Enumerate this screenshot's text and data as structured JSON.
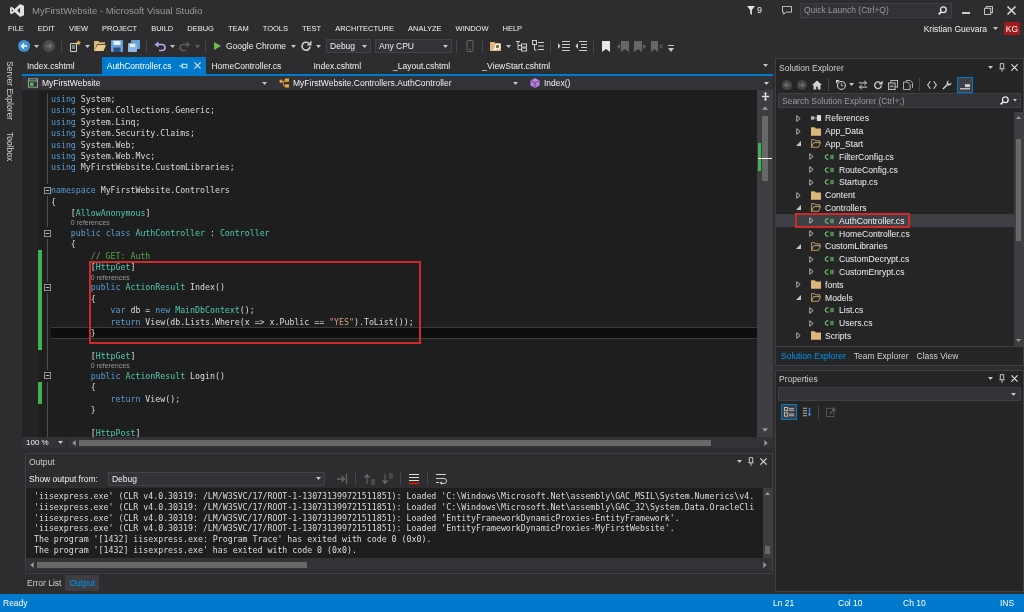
{
  "window": {
    "title": "MyFirstWebsite - Microsoft Visual Studio",
    "notifications": "9",
    "quick_launch": {
      "placeholder": "Quick Launch (Ctrl+Q)"
    },
    "user": {
      "name": "Kristian Guevara",
      "initials": "KG"
    }
  },
  "menu": [
    "FILE",
    "EDIT",
    "VIEW",
    "PROJECT",
    "BUILD",
    "DEBUG",
    "TEAM",
    "TOOLS",
    "TEST",
    "ARCHITECTURE",
    "ANALYZE",
    "WINDOW",
    "HELP"
  ],
  "toolbar": [
    {
      "kind": "back",
      "disabled": false
    },
    {
      "kind": "caret",
      "disabled": false
    },
    {
      "kind": "forward",
      "disabled": true
    },
    {
      "kind": "separator"
    },
    {
      "kind": "new-item",
      "disabled": false
    },
    {
      "kind": "caret",
      "disabled": false
    },
    {
      "kind": "open",
      "disabled": false
    },
    {
      "kind": "save",
      "disabled": false
    },
    {
      "kind": "save-all",
      "disabled": false
    },
    {
      "kind": "separator"
    },
    {
      "kind": "undo",
      "disabled": false
    },
    {
      "kind": "caret",
      "disabled": false
    },
    {
      "kind": "redo",
      "disabled": true
    },
    {
      "kind": "caret",
      "disabled": true
    },
    {
      "kind": "separator"
    },
    {
      "kind": "run",
      "label": "Google Chrome",
      "disabled": false
    },
    {
      "kind": "caret",
      "disabled": false
    },
    {
      "kind": "refresh",
      "disabled": false
    },
    {
      "kind": "caret",
      "disabled": false
    },
    {
      "kind": "combo",
      "value": "Debug",
      "disabled": false
    },
    {
      "kind": "combo",
      "value": "Any CPU",
      "disabled": false
    },
    {
      "kind": "separator"
    },
    {
      "kind": "device",
      "disabled": true
    },
    {
      "kind": "separator"
    },
    {
      "kind": "find",
      "disabled": false
    },
    {
      "kind": "caret",
      "disabled": false
    },
    {
      "kind": "outline",
      "disabled": false
    },
    {
      "kind": "list",
      "disabled": false
    },
    {
      "kind": "separator"
    },
    {
      "kind": "indent",
      "disabled": false
    },
    {
      "kind": "outdent",
      "disabled": false
    },
    {
      "kind": "separator"
    },
    {
      "kind": "bookmark",
      "disabled": false
    },
    {
      "kind": "bookmark-prev",
      "disabled": true
    },
    {
      "kind": "bookmark-next",
      "disabled": true
    },
    {
      "kind": "bookmark-clear",
      "disabled": true
    },
    {
      "kind": "overflow",
      "disabled": false
    }
  ],
  "side_tabs": [
    "Server Explorer",
    "Toolbox"
  ],
  "document_tabs": [
    {
      "label": "Index.cshtml",
      "selected": false
    },
    {
      "label": "AuthController.cs",
      "selected": true
    },
    {
      "label": "HomeController.cs",
      "selected": false
    },
    {
      "label": "Index.cshtml",
      "selected": false
    },
    {
      "label": "_Layout.cshtml",
      "selected": false
    },
    {
      "label": "_ViewStart.cshtml",
      "selected": false
    }
  ],
  "navigation": {
    "project": "MyFirstWebsite",
    "type": "MyFirstWebsite.Controllers.AuthController",
    "member": "Index()"
  },
  "editor": {
    "lines": [
      {
        "kind": "code",
        "tokens": [
          {
            "kind": "keyword",
            "text": "using"
          },
          {
            "kind": "plain",
            "text": " System;"
          }
        ],
        "fold": false,
        "changed": false,
        "current": false
      },
      {
        "kind": "code",
        "tokens": [
          {
            "kind": "keyword",
            "text": "using"
          },
          {
            "kind": "plain",
            "text": " System.Collections.Generic;"
          }
        ],
        "fold": false,
        "changed": false,
        "current": false
      },
      {
        "kind": "code",
        "tokens": [
          {
            "kind": "keyword",
            "text": "using"
          },
          {
            "kind": "plain",
            "text": " System.Linq;"
          }
        ],
        "fold": false,
        "changed": false,
        "current": false
      },
      {
        "kind": "code",
        "tokens": [
          {
            "kind": "keyword",
            "text": "using"
          },
          {
            "kind": "plain",
            "text": " System.Security.Claims;"
          }
        ],
        "fold": false,
        "changed": false,
        "current": false
      },
      {
        "kind": "code",
        "tokens": [
          {
            "kind": "keyword",
            "text": "using"
          },
          {
            "kind": "plain",
            "text": " System.Web;"
          }
        ],
        "fold": false,
        "changed": false,
        "current": false
      },
      {
        "kind": "code",
        "tokens": [
          {
            "kind": "keyword",
            "text": "using"
          },
          {
            "kind": "plain",
            "text": " System.Web.Mvc;"
          }
        ],
        "fold": false,
        "changed": false,
        "current": false
      },
      {
        "kind": "code",
        "tokens": [
          {
            "kind": "keyword",
            "text": "using"
          },
          {
            "kind": "plain",
            "text": " MyFirstWebsite.CustomLibraries;"
          }
        ],
        "fold": false,
        "changed": false,
        "current": false
      },
      {
        "kind": "blank",
        "fold": false,
        "changed": false,
        "current": false
      },
      {
        "kind": "code",
        "tokens": [
          {
            "kind": "keyword",
            "text": "namespace"
          },
          {
            "kind": "plain",
            "text": " MyFirstWebsite.Controllers"
          }
        ],
        "fold": true,
        "changed": false,
        "current": false
      },
      {
        "kind": "code",
        "tokens": [
          {
            "kind": "plain",
            "text": "{"
          }
        ],
        "fold": false,
        "changed": false,
        "current": false
      },
      {
        "kind": "code",
        "tokens": [
          {
            "kind": "plain",
            "text": "    ["
          },
          {
            "kind": "type",
            "text": "AllowAnonymous"
          },
          {
            "kind": "plain",
            "text": "]"
          }
        ],
        "fold": false,
        "changed": false,
        "current": false
      },
      {
        "kind": "codelens",
        "text": "    0 references",
        "fold": false,
        "changed": false,
        "current": false
      },
      {
        "kind": "code",
        "tokens": [
          {
            "kind": "keyword",
            "text": "    public class "
          },
          {
            "kind": "type",
            "text": "AuthController"
          },
          {
            "kind": "plain",
            "text": " : "
          },
          {
            "kind": "type",
            "text": "Controller"
          }
        ],
        "fold": true,
        "changed": false,
        "current": false
      },
      {
        "kind": "code",
        "tokens": [
          {
            "kind": "plain",
            "text": "    {"
          }
        ],
        "fold": false,
        "changed": false,
        "current": false
      },
      {
        "kind": "code",
        "tokens": [
          {
            "kind": "comment",
            "text": "        // GET: Auth"
          }
        ],
        "fold": false,
        "changed": true,
        "current": false
      },
      {
        "kind": "frame",
        "lines": [
          {
            "kind": "code",
            "tokens": [
              {
                "kind": "plain",
                "text": "        ["
              },
              {
                "kind": "type",
                "text": "HttpGet"
              },
              {
                "kind": "plain",
                "text": "]"
              }
            ],
            "fold": false,
            "changed": true,
            "current": false
          },
          {
            "kind": "codelens",
            "text": "        0 references",
            "fold": false,
            "changed": true,
            "current": false
          },
          {
            "kind": "code",
            "tokens": [
              {
                "kind": "keyword",
                "text": "        public "
              },
              {
                "kind": "type",
                "text": "ActionResult"
              },
              {
                "kind": "plain",
                "text": " Index()"
              }
            ],
            "fold": true,
            "changed": true,
            "current": false
          },
          {
            "kind": "code",
            "tokens": [
              {
                "kind": "plain",
                "text": "        {"
              }
            ],
            "fold": false,
            "changed": true,
            "current": false
          },
          {
            "kind": "code",
            "tokens": [
              {
                "kind": "keyword",
                "text": "            var"
              },
              {
                "kind": "plain",
                "text": " db = "
              },
              {
                "kind": "keyword",
                "text": "new "
              },
              {
                "kind": "type",
                "text": "MainDbContext"
              },
              {
                "kind": "plain",
                "text": "();"
              }
            ],
            "fold": false,
            "changed": true,
            "current": false
          },
          {
            "kind": "code",
            "tokens": [
              {
                "kind": "keyword",
                "text": "            return"
              },
              {
                "kind": "plain",
                "text": " View(db.Lists.Where(x => x.Public == "
              },
              {
                "kind": "string",
                "text": "\"YES\""
              },
              {
                "kind": "plain",
                "text": ").ToList());"
              }
            ],
            "fold": false,
            "changed": true,
            "current": false
          },
          {
            "kind": "code",
            "tokens": [
              {
                "kind": "plain",
                "text": "        }"
              }
            ],
            "fold": false,
            "changed": true,
            "current": true
          }
        ]
      },
      {
        "kind": "blank",
        "fold": false,
        "changed": true,
        "current": false
      },
      {
        "kind": "code",
        "tokens": [
          {
            "kind": "plain",
            "text": "        ["
          },
          {
            "kind": "type",
            "text": "HttpGet"
          },
          {
            "kind": "plain",
            "text": "]"
          }
        ],
        "fold": false,
        "changed": false,
        "current": false
      },
      {
        "kind": "codelens",
        "text": "        0 references",
        "fold": false,
        "changed": false,
        "current": false
      },
      {
        "kind": "code",
        "tokens": [
          {
            "kind": "keyword",
            "text": "        public "
          },
          {
            "kind": "type",
            "text": "ActionResult"
          },
          {
            "kind": "plain",
            "text": " Login()"
          }
        ],
        "fold": true,
        "changed": false,
        "current": false
      },
      {
        "kind": "code",
        "tokens": [
          {
            "kind": "plain",
            "text": "        {"
          }
        ],
        "fold": false,
        "changed": true,
        "current": false
      },
      {
        "kind": "code",
        "tokens": [
          {
            "kind": "keyword",
            "text": "            return"
          },
          {
            "kind": "plain",
            "text": " View();"
          }
        ],
        "fold": false,
        "changed": true,
        "current": false
      },
      {
        "kind": "code",
        "tokens": [
          {
            "kind": "plain",
            "text": "        }"
          }
        ],
        "fold": false,
        "changed": false,
        "current": false
      },
      {
        "kind": "blank",
        "fold": false,
        "changed": false,
        "current": false
      },
      {
        "kind": "code",
        "tokens": [
          {
            "kind": "plain",
            "text": "        ["
          },
          {
            "kind": "type",
            "text": "HttpPost"
          },
          {
            "kind": "plain",
            "text": "]"
          }
        ],
        "fold": false,
        "changed": false,
        "current": false
      }
    ],
    "zoom": "100 %"
  },
  "output": {
    "title": "Output",
    "source_label": "Show output from:",
    "source": "Debug",
    "toolbar": [
      {
        "kind": "msg-goto",
        "disabled": true
      },
      {
        "kind": "separator"
      },
      {
        "kind": "msg-prev",
        "disabled": true
      },
      {
        "kind": "msg-next",
        "disabled": true
      },
      {
        "kind": "separator"
      },
      {
        "kind": "clear",
        "disabled": false
      },
      {
        "kind": "separator"
      },
      {
        "kind": "wrap",
        "disabled": false
      }
    ],
    "lines": [
      "'iisexpress.exe' (CLR v4.0.30319: /LM/W3SVC/17/ROOT-1-130731399721511851): Loaded 'C:\\Windows\\Microsoft.Net\\assembly\\GAC_MSIL\\System.Numerics\\v4.",
      "'iisexpress.exe' (CLR v4.0.30319: /LM/W3SVC/17/ROOT-1-130731399721511851): Loaded 'C:\\Windows\\Microsoft.Net\\assembly\\GAC_32\\System.Data.OracleCli",
      "'iisexpress.exe' (CLR v4.0.30319: /LM/W3SVC/17/ROOT-1-130731399721511851): Loaded 'EntityFrameworkDynamicProxies-EntityFramework'.",
      "'iisexpress.exe' (CLR v4.0.30319: /LM/W3SVC/17/ROOT-1-130731399721511851): Loaded 'EntityFrameworkDynamicProxies-MyFirstWebsite'.",
      "The program '[1432] iisexpress.exe: Program Trace' has exited with code 0 (0x0).",
      "The program '[1432] iisexpress.exe' has exited with code 0 (0x0)."
    ]
  },
  "bottom_tabs": [
    {
      "label": "Error List",
      "selected": false
    },
    {
      "label": "Output",
      "selected": true
    }
  ],
  "solution_explorer": {
    "title": "Solution Explorer",
    "toolbar": [
      {
        "kind": "back",
        "disabled": true,
        "selected": false
      },
      {
        "kind": "forward",
        "disabled": true,
        "selected": false
      },
      {
        "kind": "home",
        "disabled": false,
        "selected": false
      },
      {
        "kind": "separator"
      },
      {
        "kind": "history",
        "disabled": false,
        "selected": false
      },
      {
        "kind": "caret",
        "disabled": false,
        "selected": false
      },
      {
        "kind": "sync",
        "disabled": false,
        "selected": false
      },
      {
        "kind": "refresh",
        "disabled": false,
        "selected": false
      },
      {
        "kind": "collapse",
        "disabled": false,
        "selected": false
      },
      {
        "kind": "show-all",
        "disabled": false,
        "selected": false
      },
      {
        "kind": "separator"
      },
      {
        "kind": "code",
        "disabled": false,
        "selected": false
      },
      {
        "kind": "wrench",
        "disabled": false,
        "selected": false
      },
      {
        "kind": "preview",
        "disabled": false,
        "selected": true
      }
    ],
    "search": {
      "placeholder": "Search Solution Explorer (Ctrl+;)"
    },
    "tree": [
      {
        "label": "References",
        "kind": "references",
        "expanded": false,
        "selected": false
      },
      {
        "label": "App_Data",
        "kind": "folder",
        "expanded": false,
        "selected": false
      },
      {
        "label": "App_Start",
        "kind": "folder",
        "expanded": true,
        "selected": false,
        "children": [
          {
            "label": "FilterConfig.cs",
            "kind": "csharp",
            "expanded": false,
            "selected": false
          },
          {
            "label": "RouteConfig.cs",
            "kind": "csharp",
            "expanded": false,
            "selected": false
          },
          {
            "label": "Startup.cs",
            "kind": "csharp",
            "expanded": false,
            "selected": false
          }
        ]
      },
      {
        "label": "Content",
        "kind": "folder",
        "expanded": false,
        "selected": false
      },
      {
        "label": "Controllers",
        "kind": "folder",
        "expanded": true,
        "selected": false,
        "children": [
          {
            "kind": "frame",
            "items": [
              {
                "label": "AuthController.cs",
                "kind": "csharp",
                "expanded": false,
                "selected": true
              }
            ]
          },
          {
            "label": "HomeController.cs",
            "kind": "csharp",
            "expanded": false,
            "selected": false
          }
        ]
      },
      {
        "label": "CustomLibraries",
        "kind": "folder",
        "expanded": true,
        "selected": false,
        "children": [
          {
            "label": "CustomDecrypt.cs",
            "kind": "csharp",
            "expanded": false,
            "selected": false
          },
          {
            "label": "CustomEnrypt.cs",
            "kind": "csharp",
            "expanded": false,
            "selected": false
          }
        ]
      },
      {
        "label": "fonts",
        "kind": "folder",
        "expanded": false,
        "selected": false
      },
      {
        "label": "Models",
        "kind": "folder",
        "expanded": true,
        "selected": false,
        "children": [
          {
            "label": "List.cs",
            "kind": "csharp",
            "expanded": false,
            "selected": false
          },
          {
            "label": "Users.cs",
            "kind": "csharp",
            "expanded": false,
            "selected": false
          }
        ]
      },
      {
        "label": "Scripts",
        "kind": "folder",
        "expanded": false,
        "selected": false
      }
    ],
    "tabs": [
      {
        "label": "Solution Explorer",
        "selected": true
      },
      {
        "label": "Team Explorer",
        "selected": false
      },
      {
        "label": "Class View",
        "selected": false
      }
    ]
  },
  "properties": {
    "title": "Properties",
    "toolbar": [
      {
        "kind": "categorized",
        "disabled": false,
        "selected": true
      },
      {
        "kind": "alphabetical",
        "disabled": false,
        "selected": false
      },
      {
        "kind": "separator"
      },
      {
        "kind": "property-pages",
        "disabled": true,
        "selected": false
      }
    ]
  },
  "status_bar": {
    "message": "Ready",
    "line": "Ln 21",
    "column": "Col 10",
    "char": "Ch 10",
    "mode": "INS"
  }
}
